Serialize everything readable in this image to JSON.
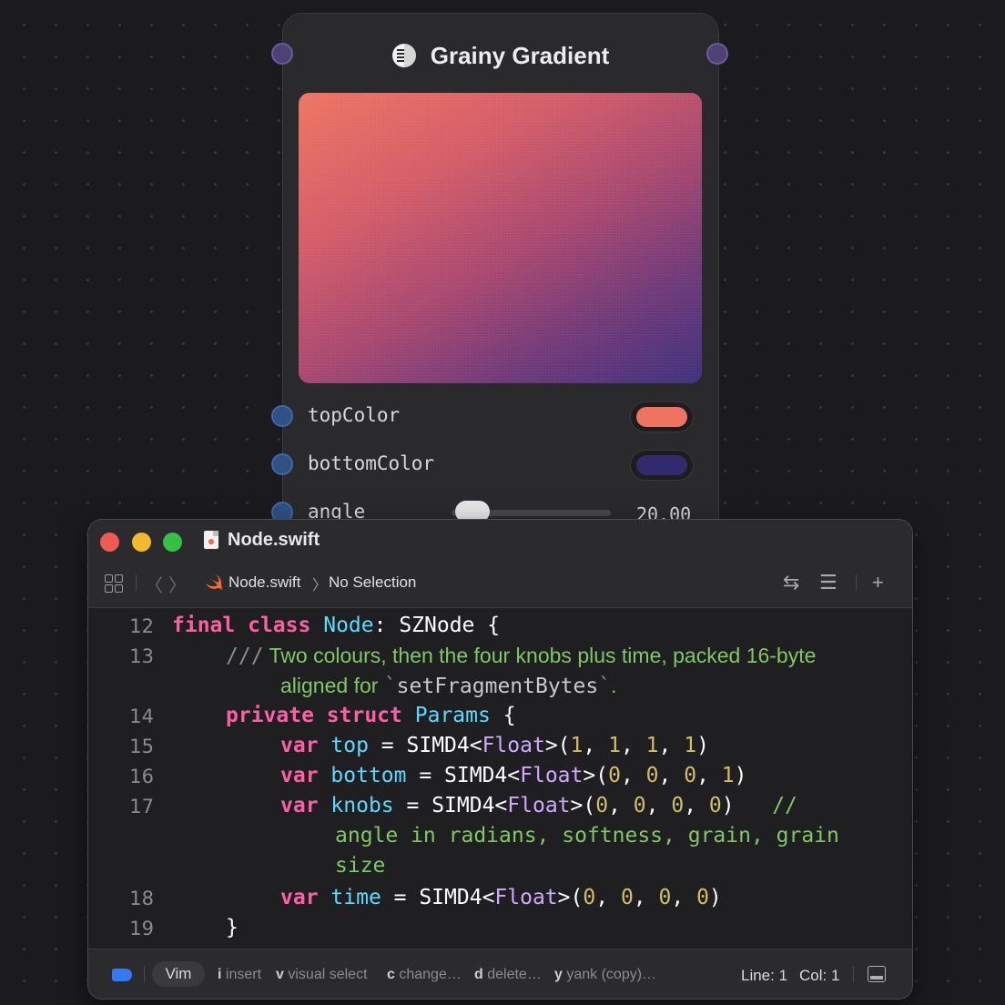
{
  "node": {
    "title": "Grainy Gradient",
    "icon": "grain-gradient-icon",
    "params": [
      {
        "label": "topColor",
        "color": "#ee7461"
      },
      {
        "label": "bottomColor",
        "color": "#332a6e"
      },
      {
        "label": "angle",
        "value": "20.00"
      }
    ],
    "gradient_colors": [
      "#ee7461",
      "#a8476f",
      "#3f2f7c"
    ]
  },
  "window": {
    "file_name": "Node.swift",
    "breadcrumb": {
      "file": "Node.swift",
      "selection": "No Selection"
    },
    "code": {
      "line_numbers": [
        "12",
        "13",
        "14",
        "15",
        "16",
        "17",
        "18",
        "19"
      ],
      "l12": {
        "kw1": "final",
        "kw2": "class",
        "name": "Node",
        "colon": ": ",
        "super": "SZNode",
        "brace": " {"
      },
      "l13": {
        "slashes": "///",
        "text1": " Two colours, then the four knobs plus time, packed 16-byte",
        "text2": "aligned for ",
        "tick_open": "`",
        "code": "setFragmentBytes",
        "tick_close": "`",
        "period": "."
      },
      "l14": {
        "kw1": "private",
        "kw2": "struct",
        "name": "Params",
        "brace": " {"
      },
      "l15": {
        "kw": "var",
        "name": "top",
        "eq": " = SIMD4<",
        "type": "Float",
        "open": ">(",
        "v1": "1",
        "v2": "1",
        "v3": "1",
        "v4": "1",
        "close": ")"
      },
      "l16": {
        "kw": "var",
        "name": "bottom",
        "eq": " = SIMD4<",
        "type": "Float",
        "open": ">(",
        "v1": "0",
        "v2": "0",
        "v3": "0",
        "v4": "1",
        "close": ")"
      },
      "l17": {
        "kw": "var",
        "name": "knobs",
        "eq": " = SIMD4<",
        "type": "Float",
        "open": ">(",
        "v1": "0",
        "v2": "0",
        "v3": "0",
        "v4": "0",
        "close": ")",
        "comment1": "//",
        "comment2": "angle in radians, softness, grain, grain",
        "comment3": "size"
      },
      "l18": {
        "kw": "var",
        "name": "time",
        "eq": " = SIMD4<",
        "type": "Float",
        "open": ">(",
        "v1": "0",
        "v2": "0",
        "v3": "0",
        "v4": "0",
        "close": ")"
      },
      "l19": {
        "brace": "}"
      }
    },
    "status": {
      "mode": "Vim",
      "hints": [
        {
          "key": "i",
          "label": "insert"
        },
        {
          "key": "v",
          "label": "visual select"
        },
        {
          "key": "c",
          "label": "change…"
        },
        {
          "key": "d",
          "label": "delete…"
        },
        {
          "key": "y",
          "label": "yank (copy)…"
        }
      ],
      "line": "Line: 1",
      "col": "Col: 1"
    }
  }
}
